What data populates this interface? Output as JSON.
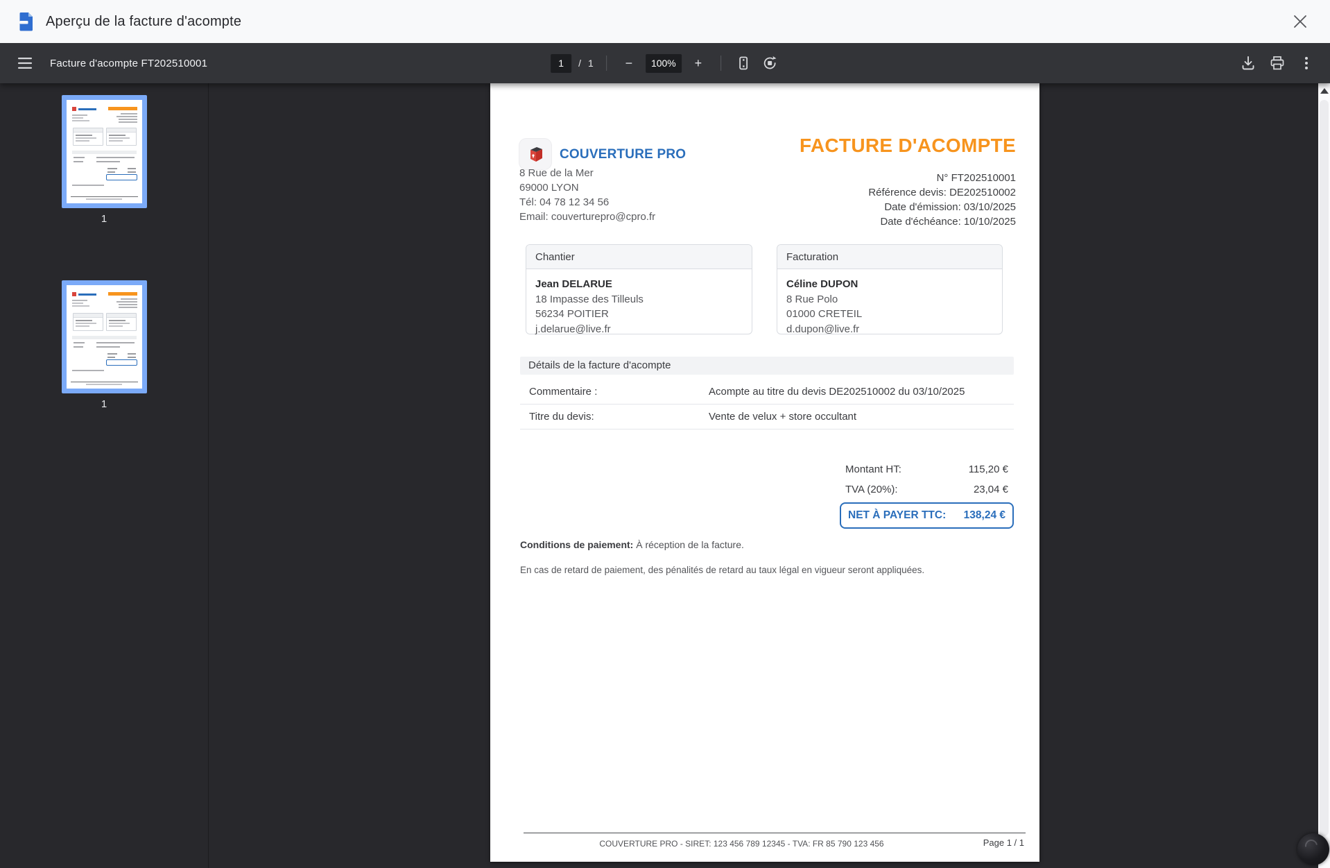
{
  "header": {
    "title": "Aperçu de la facture d'acompte"
  },
  "toolbar": {
    "document_title": "Facture d'acompte FT202510001",
    "page_current": "1",
    "page_separator": "/",
    "page_count": "1",
    "zoom_out": "−",
    "zoom_level": "100%",
    "zoom_in": "+"
  },
  "sidebar": {
    "thumbnails": [
      {
        "label": "1"
      },
      {
        "label": "1"
      }
    ]
  },
  "invoice": {
    "company": {
      "name": "COUVERTURE PRO",
      "address": [
        "8 Rue de la Mer",
        "69000 LYON",
        "Tél: 04 78 12 34 56",
        "Email: couverturepro@cpro.fr"
      ]
    },
    "title": "FACTURE D'ACOMPTE",
    "meta": [
      "N° FT202510001",
      "Référence devis: DE202510002",
      "Date d'émission: 03/10/2025",
      "Date d'échéance: 10/10/2025"
    ],
    "site_box": {
      "title": "Chantier",
      "name": "Jean DELARUE",
      "lines": [
        "18 Impasse des Tilleuls",
        "56234 POITIER",
        "j.delarue@live.fr"
      ]
    },
    "billing_box": {
      "title": "Facturation",
      "name": "Céline DUPON",
      "lines": [
        "8 Rue Polo",
        "01000 CRETEIL",
        "d.dupon@live.fr"
      ]
    },
    "details_heading": "Détails de la facture d'acompte",
    "detail_rows": [
      {
        "label": "Commentaire :",
        "value": "Acompte au titre du devis DE202510002 du 03/10/2025"
      },
      {
        "label": "Titre du devis:",
        "value": "Vente de velux + store occultant"
      }
    ],
    "totals": {
      "ht_label": "Montant HT:",
      "ht_value": "115,20 €",
      "tva_label": "TVA (20%):",
      "tva_value": "23,04 €",
      "net_label": "NET À PAYER TTC:",
      "net_value": "138,24 €"
    },
    "payment_terms_label": "Conditions de paiement:",
    "payment_terms_value": "À réception de la facture.",
    "late_payment_notice": "En cas de retard de paiement, des pénalités de retard au taux légal en vigueur seront appliquées.",
    "footer": {
      "company_line": "COUVERTURE PRO - SIRET: 123 456 789 12345 - TVA: FR 85 790 123 456",
      "page_label": "Page 1 / 1"
    }
  },
  "colors": {
    "accent_orange": "#f7941e",
    "accent_blue": "#2a6ebb",
    "thumbnail_highlight": "#7baaf8",
    "toolbar_bg": "#333438"
  }
}
